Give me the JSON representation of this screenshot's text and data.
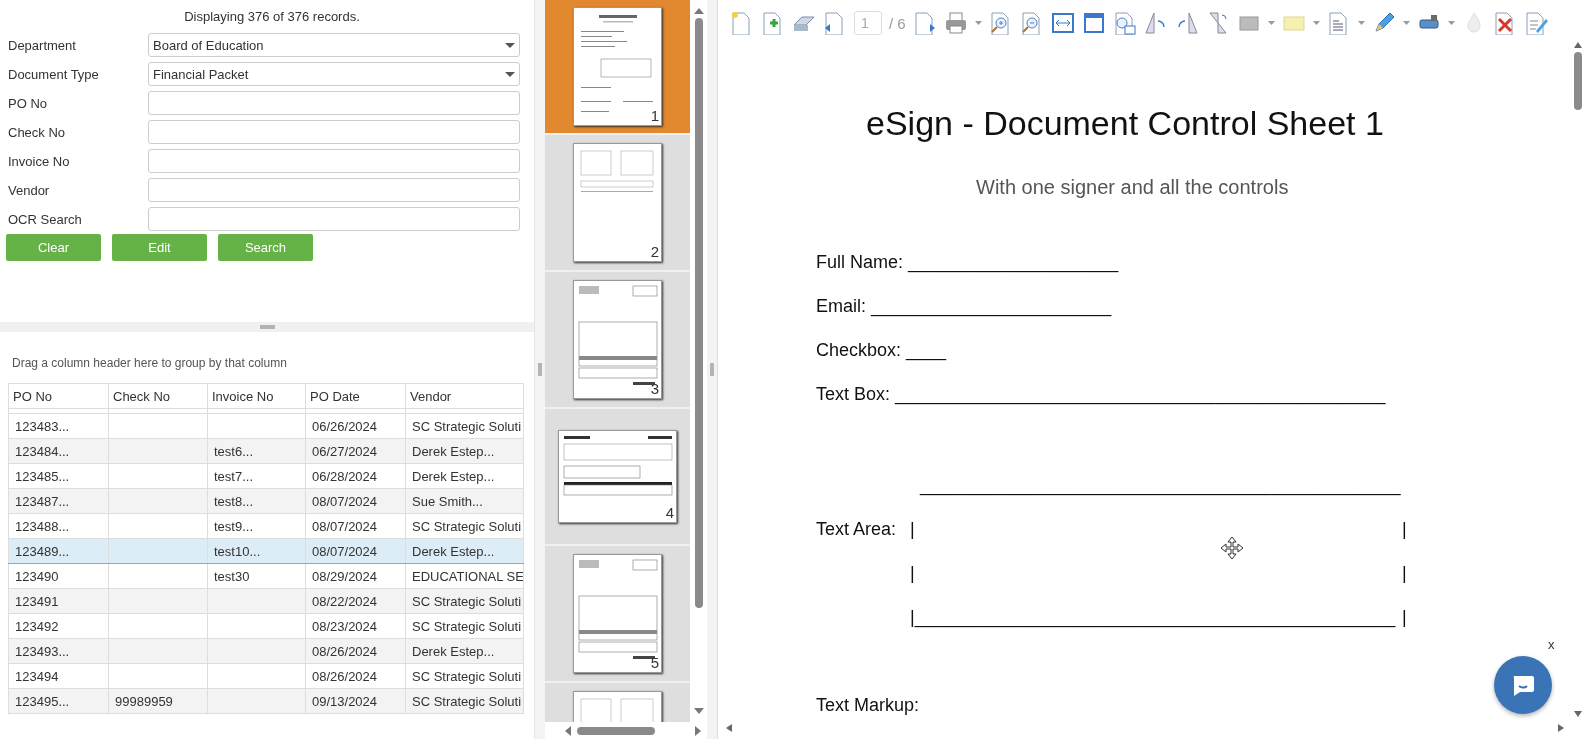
{
  "search_form": {
    "status": "Displaying 376 of 376 records.",
    "fields": [
      {
        "label": "Department",
        "kind": "dropdown",
        "value": "Board of Education"
      },
      {
        "label": "Document Type",
        "kind": "dropdown",
        "value": "Financial Packet"
      },
      {
        "label": "PO No",
        "kind": "text"
      },
      {
        "label": "Check No",
        "kind": "text"
      },
      {
        "label": "Invoice No",
        "kind": "text"
      },
      {
        "label": "Vendor",
        "kind": "text"
      },
      {
        "label": "OCR Search",
        "kind": "text"
      }
    ],
    "buttons": [
      "Clear",
      "Edit",
      "Search"
    ]
  },
  "grid": {
    "group_hint": "Drag a column header here to group by that column",
    "columns": [
      "PO No",
      "Check No",
      "Invoice No",
      "PO Date",
      "Vendor"
    ],
    "rows": [
      {
        "cells": [
          "123483...",
          "",
          "",
          "06/26/2024",
          "SC Strategic Soluti"
        ],
        "selected": false
      },
      {
        "cells": [
          "123484...",
          "",
          "test6...",
          "06/27/2024",
          "Derek Estep..."
        ],
        "selected": false
      },
      {
        "cells": [
          "123485...",
          "",
          "test7...",
          "06/28/2024",
          "Derek Estep..."
        ],
        "selected": false
      },
      {
        "cells": [
          "123487...",
          "",
          "test8...",
          "08/07/2024",
          "Sue Smith..."
        ],
        "selected": false
      },
      {
        "cells": [
          "123488...",
          "",
          "test9...",
          "08/07/2024",
          "SC Strategic Soluti"
        ],
        "selected": false
      },
      {
        "cells": [
          "123489...",
          "",
          "test10...",
          "08/07/2024",
          "Derek Estep..."
        ],
        "selected": true
      },
      {
        "cells": [
          "123490",
          "",
          "test30",
          "08/29/2024",
          "EDUCATIONAL SE"
        ],
        "selected": false
      },
      {
        "cells": [
          "123491",
          "",
          "",
          "08/22/2024",
          "SC Strategic Soluti"
        ],
        "selected": false
      },
      {
        "cells": [
          "123492",
          "",
          "",
          "08/23/2024",
          "SC Strategic Soluti"
        ],
        "selected": false
      },
      {
        "cells": [
          "123493...",
          "",
          "",
          "08/26/2024",
          "Derek Estep..."
        ],
        "selected": false
      },
      {
        "cells": [
          "123494",
          "",
          "",
          "08/26/2024",
          "SC Strategic Soluti"
        ],
        "selected": false
      },
      {
        "cells": [
          "123495...",
          "99989959",
          "",
          "09/13/2024",
          "SC Strategic Soluti"
        ],
        "selected": false
      }
    ]
  },
  "thumbnails": [
    {
      "page": "1",
      "kind": "form",
      "selected": true
    },
    {
      "page": "2",
      "kind": "sparse",
      "selected": false
    },
    {
      "page": "3",
      "kind": "invoice",
      "selected": false
    },
    {
      "page": "4",
      "kind": "landscape",
      "selected": false
    },
    {
      "page": "5",
      "kind": "invoice",
      "selected": false
    },
    {
      "kind": "sparse",
      "selected": false
    }
  ],
  "viewer": {
    "page_value": "1",
    "page_total": "/ 6",
    "document": {
      "title": "eSign - Document Control Sheet 1",
      "subtitle": "With one signer and all the controls",
      "lines": [
        {
          "kind": "field",
          "label": "Full Name:",
          "blank": "_____________________"
        },
        {
          "kind": "field",
          "label": "Email:",
          "blank": "________________________"
        },
        {
          "kind": "field",
          "label": "Checkbox:",
          "blank": "____"
        },
        {
          "kind": "field",
          "label": "Text Box:",
          "blank": "_________________________________________________"
        },
        {
          "kind": "rule",
          "blank": "________________________________________________"
        },
        {
          "kind": "area",
          "label": "Text Area:",
          "rows": [
            {
              "left": "|",
              "right": "|"
            },
            {
              "left": "|",
              "right": "|"
            },
            {
              "left": "|________________________________________________",
              "right": "|"
            }
          ]
        },
        {
          "kind": "field",
          "label": "Text Markup:"
        }
      ]
    }
  },
  "chat": {
    "close": "x"
  }
}
